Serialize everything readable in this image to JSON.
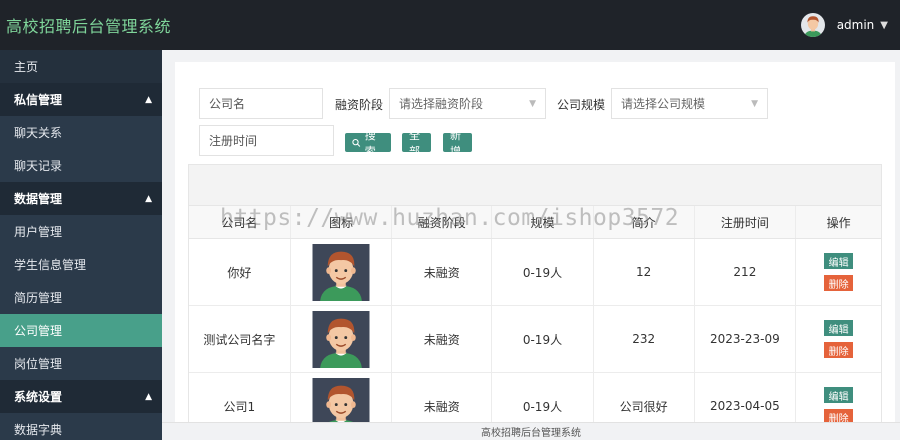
{
  "header": {
    "title": "高校招聘后台管理系统",
    "username": "admin"
  },
  "sidebar": {
    "items": [
      {
        "label": "主页",
        "type": "home"
      },
      {
        "label": "私信管理",
        "type": "group"
      },
      {
        "label": "聊天关系",
        "type": "sub"
      },
      {
        "label": "聊天记录",
        "type": "sub"
      },
      {
        "label": "数据管理",
        "type": "group"
      },
      {
        "label": "用户管理",
        "type": "sub"
      },
      {
        "label": "学生信息管理",
        "type": "sub"
      },
      {
        "label": "简历管理",
        "type": "sub"
      },
      {
        "label": "公司管理",
        "type": "active"
      },
      {
        "label": "岗位管理",
        "type": "sub"
      },
      {
        "label": "系统设置",
        "type": "group"
      },
      {
        "label": "数据字典",
        "type": "sub"
      }
    ]
  },
  "filters": {
    "company_name_placeholder": "公司名",
    "funding_label": "融资阶段",
    "funding_placeholder": "请选择融资阶段",
    "scale_label": "公司规模",
    "scale_placeholder": "请选择公司规模",
    "reg_time_placeholder": "注册时间",
    "search_label": "搜索",
    "all_label": "全部",
    "add_label": "新增"
  },
  "table": {
    "columns": [
      "公司名",
      "图标",
      "融资阶段",
      "规模",
      "简介",
      "注册时间",
      "操作"
    ],
    "rows": [
      {
        "name": "你好",
        "funding": "未融资",
        "scale": "0-19人",
        "intro": "12",
        "reg_time": "212"
      },
      {
        "name": "测试公司名字",
        "funding": "未融资",
        "scale": "0-19人",
        "intro": "232",
        "reg_time": "2023-23-09"
      },
      {
        "name": "公司1",
        "funding": "未融资",
        "scale": "0-19人",
        "intro": "公司很好",
        "reg_time": "2023-04-05"
      }
    ],
    "edit_label": "编辑",
    "delete_label": "删除"
  },
  "watermark": "https://www.huzhan.com/ishop3572",
  "footer": {
    "text": "高校招聘后台管理系统"
  },
  "colors": {
    "brand": "#7fd59a",
    "accent": "#3f8e7e",
    "danger": "#e5633b",
    "sidebar_active": "#48a08a"
  }
}
